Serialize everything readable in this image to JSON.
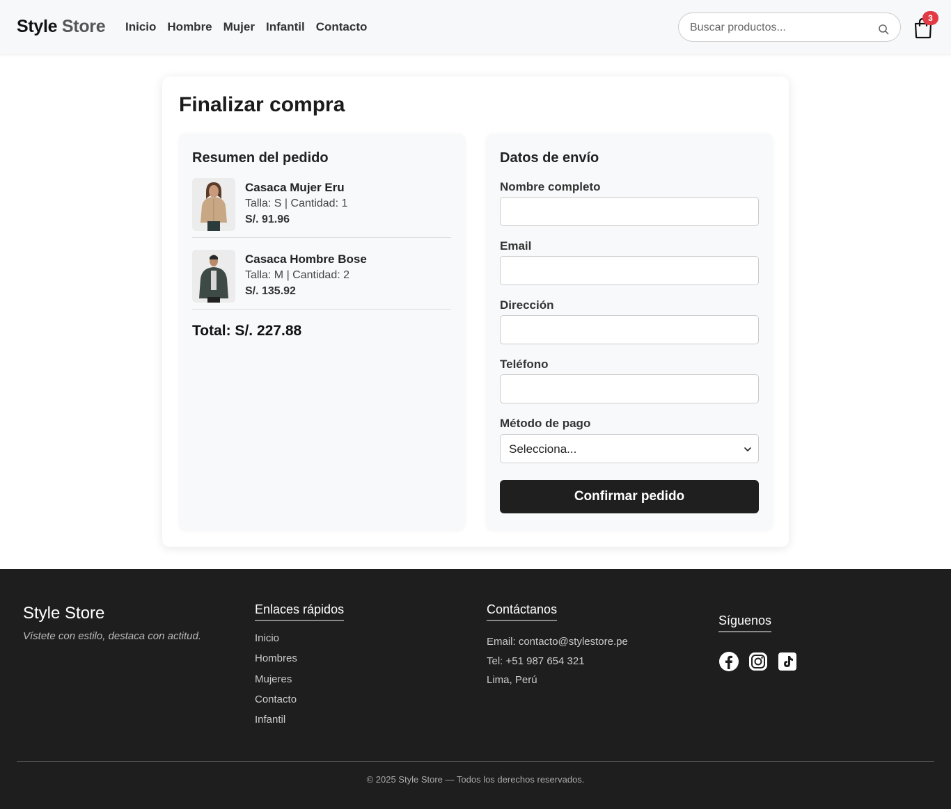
{
  "header": {
    "brand_part1": "Style",
    "brand_part2": "Store",
    "nav": [
      "Inicio",
      "Hombre",
      "Mujer",
      "Infantil",
      "Contacto"
    ],
    "search_placeholder": "Buscar productos...",
    "cart_count": "3"
  },
  "checkout": {
    "title": "Finalizar compra",
    "summary": {
      "title": "Resumen del pedido",
      "items": [
        {
          "name": "Casaca Mujer Eru",
          "meta": "Talla: S | Cantidad: 1",
          "price": "S/. 91.96"
        },
        {
          "name": "Casaca Hombre Bose",
          "meta": "Talla: M | Cantidad: 2",
          "price": "S/. 135.92"
        }
      ],
      "total": "Total: S/. 227.88"
    },
    "shipping": {
      "title": "Datos de envío",
      "fields": [
        "Nombre completo",
        "Email",
        "Dirección",
        "Teléfono"
      ],
      "payment_label": "Método de pago",
      "payment_value": "Selecciona...",
      "confirm_label": "Confirmar pedido"
    }
  },
  "footer": {
    "brand": "Style Store",
    "tagline": "Vístete con estilo, destaca con actitud.",
    "links_title": "Enlaces rápidos",
    "links": [
      "Inicio",
      "Hombres",
      "Mujeres",
      "Contacto",
      "Infantil"
    ],
    "contact_title": "Contáctanos",
    "contact": [
      "Email: contacto@stylestore.pe",
      "Tel: +51 987 654 321",
      "Lima, Perú"
    ],
    "social_title": "Síguenos",
    "social_icons": [
      "facebook-icon",
      "instagram-icon",
      "tiktok-icon"
    ],
    "copyright": "© 2025 Style Store — Todos los derechos reservados."
  },
  "colors": {
    "badge": "#e23a45",
    "button": "#1f1f1f",
    "footer_bg": "#1e1e1e"
  }
}
